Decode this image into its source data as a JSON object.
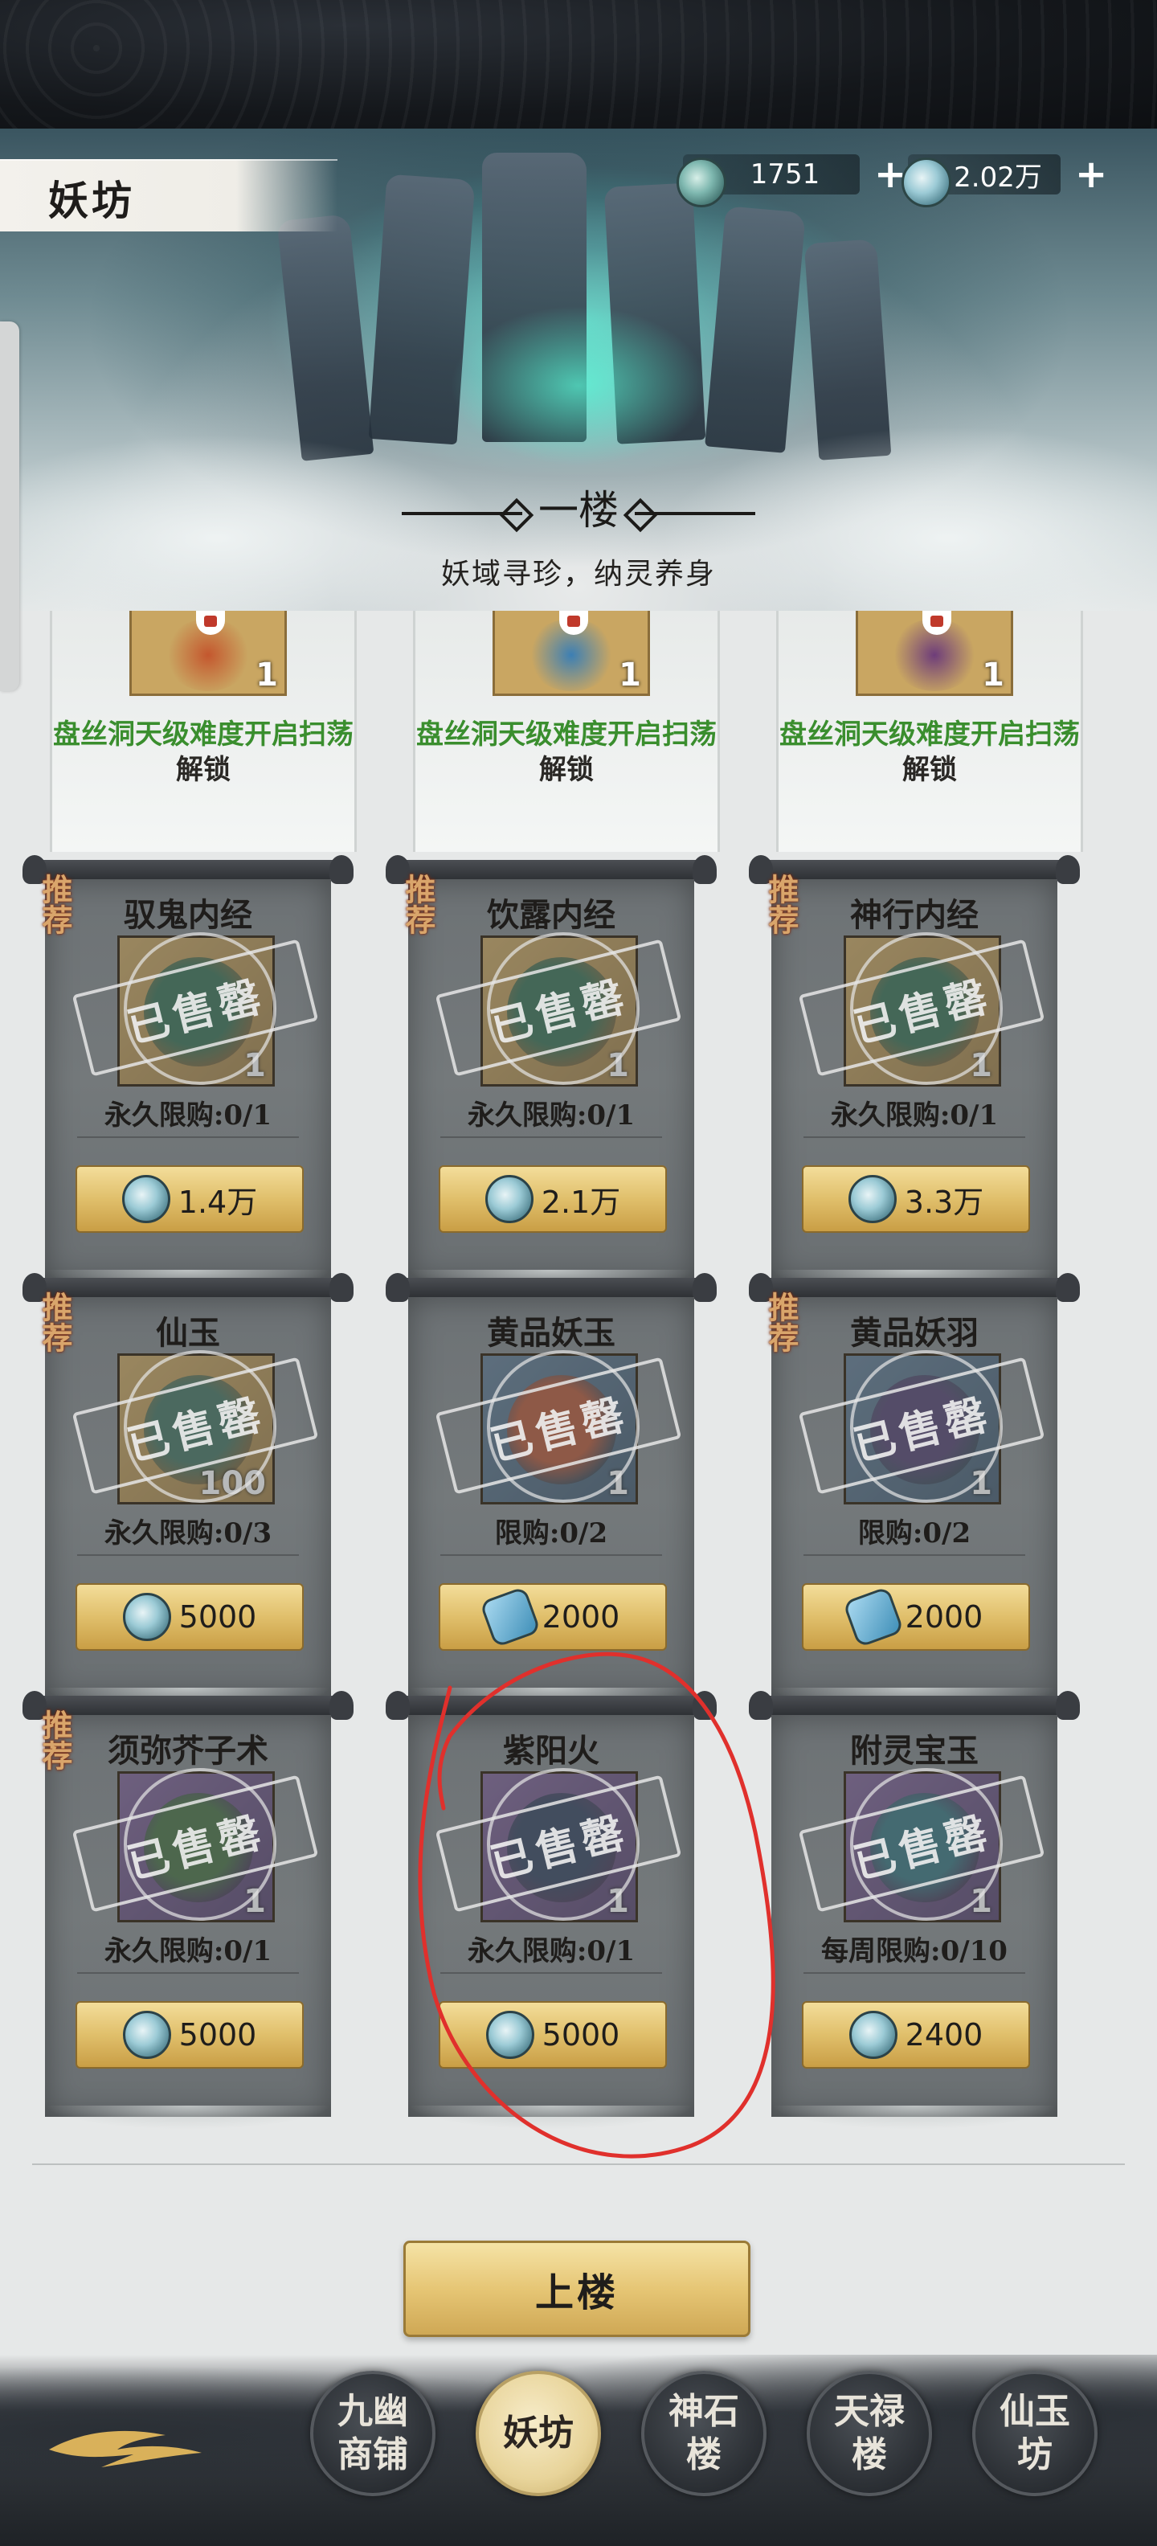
{
  "header": {
    "title": "妖坊",
    "currency": [
      {
        "icon": "jade-ring-icon",
        "value": "1751"
      },
      {
        "icon": "jade-pendant-icon",
        "value": "2.02万"
      }
    ],
    "plus_label": "+"
  },
  "floor": {
    "name": "一楼",
    "subtitle": "妖域寻珍，纳灵养身"
  },
  "locked_row": [
    {
      "qty": "1",
      "desc_green": "盘丝洞天级难度开启扫荡",
      "desc_dark": "解锁",
      "orb_color": "#c4572e"
    },
    {
      "qty": "1",
      "desc_green": "盘丝洞天级难度开启扫荡",
      "desc_dark": "解锁",
      "orb_color": "#3c7fb4"
    },
    {
      "qty": "1",
      "desc_green": "盘丝洞天级难度开启扫荡",
      "desc_dark": "解锁",
      "orb_color": "#6e3d7a"
    }
  ],
  "sold_label": "已售罄",
  "recommend_label": "推荐",
  "products": [
    {
      "name": "驭鬼内经",
      "qty": "1",
      "limit": "永久限购:0/1",
      "price": "1.4万",
      "currency": "jade",
      "recommend": true,
      "frame": "gold",
      "item_color": "#2e6b4c"
    },
    {
      "name": "饮露内经",
      "qty": "1",
      "limit": "永久限购:0/1",
      "price": "2.1万",
      "currency": "jade",
      "recommend": true,
      "frame": "gold",
      "item_color": "#2e6b4c"
    },
    {
      "name": "神行内经",
      "qty": "1",
      "limit": "永久限购:0/1",
      "price": "3.3万",
      "currency": "jade",
      "recommend": true,
      "frame": "gold",
      "item_color": "#2e6b4c"
    },
    {
      "name": "仙玉",
      "qty": "100",
      "limit": "永久限购:0/3",
      "price": "5000",
      "currency": "jade",
      "recommend": true,
      "frame": "gold",
      "item_color": "#3b6e5a"
    },
    {
      "name": "黄品妖玉",
      "qty": "1",
      "limit": "限购:0/2",
      "price": "2000",
      "currency": "crystal",
      "recommend": false,
      "frame": "blue",
      "item_color": "#b4502e"
    },
    {
      "name": "黄品妖羽",
      "qty": "1",
      "limit": "限购:0/2",
      "price": "2000",
      "currency": "crystal",
      "recommend": true,
      "frame": "blue",
      "item_color": "#4c3a6a"
    },
    {
      "name": "须弥芥子术",
      "qty": "1",
      "limit": "永久限购:0/1",
      "price": "5000",
      "currency": "jade",
      "recommend": true,
      "frame": "purple",
      "item_color": "#3e6b3a"
    },
    {
      "name": "紫阳火",
      "qty": "1",
      "limit": "永久限购:0/1",
      "price": "5000",
      "currency": "jade",
      "recommend": false,
      "frame": "purple",
      "item_color": "#2a3b58"
    },
    {
      "name": "附灵宝玉",
      "qty": "1",
      "limit": "每周限购:0/10",
      "price": "2400",
      "currency": "jade",
      "recommend": false,
      "frame": "purple",
      "item_color": "#2f6f7a"
    }
  ],
  "upstairs_label": "上楼",
  "nav": [
    {
      "label": "九幽商铺",
      "active": false
    },
    {
      "label": "妖坊",
      "active": true
    },
    {
      "label": "神石楼",
      "active": false
    },
    {
      "label": "天禄楼",
      "active": false
    },
    {
      "label": "仙玉坊",
      "active": false
    }
  ],
  "colors": {
    "accent_gold": "#e0bf6b",
    "unlock_green": "#3a8e2e",
    "annotation_red": "#e0302c"
  }
}
